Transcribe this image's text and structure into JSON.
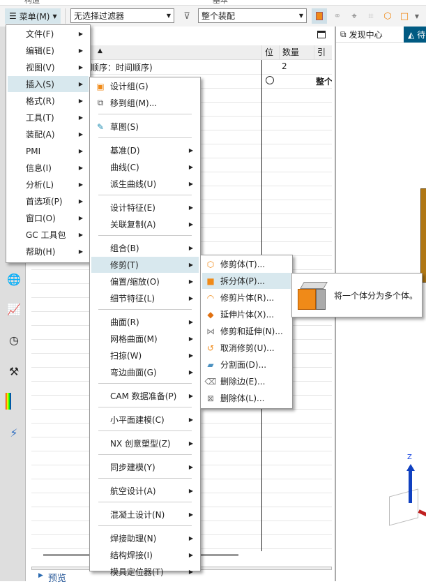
{
  "top_labels": [
    "构造",
    "基本"
  ],
  "toolbar": {
    "menu_label": "菜单(M)",
    "filter_value": "无选择过滤器",
    "scope_value": "整个装配"
  },
  "navigator": {
    "columns": [
      "位",
      "数量",
      "引"
    ],
    "row1_name": "顺序：时间顺序)",
    "row1_qty": "2",
    "row2_ref": "整个",
    "preview_label": "预览"
  },
  "right_panel": {
    "tabs": [
      "发现中心",
      "待"
    ],
    "axis_label": "Z"
  },
  "colors": {
    "accent": "#005a82",
    "hover": "#d8e8ee",
    "orange": "#f08a18"
  },
  "main_menu": [
    {
      "label": "文件(F)"
    },
    {
      "label": "编辑(E)"
    },
    {
      "label": "视图(V)"
    },
    {
      "label": "插入(S)",
      "hover": true
    },
    {
      "label": "格式(R)"
    },
    {
      "label": "工具(T)"
    },
    {
      "label": "装配(A)"
    },
    {
      "label": "PMI"
    },
    {
      "label": "信息(I)"
    },
    {
      "label": "分析(L)"
    },
    {
      "label": "首选项(P)"
    },
    {
      "label": "窗口(O)"
    },
    {
      "label": "GC 工具包"
    },
    {
      "label": "帮助(H)"
    }
  ],
  "insert_menu": [
    {
      "label": "设计组(G)",
      "icon": "design-group-icon",
      "arrow": false
    },
    {
      "label": "移到组(M)...",
      "icon": "move-to-group-icon",
      "arrow": false
    },
    {
      "sep": true
    },
    {
      "label": "草图(S)",
      "icon": "sketch-icon",
      "arrow": false
    },
    {
      "sep": true
    },
    {
      "label": "基准(D)"
    },
    {
      "label": "曲线(C)"
    },
    {
      "label": "派生曲线(U)"
    },
    {
      "sep": true
    },
    {
      "label": "设计特征(E)"
    },
    {
      "label": "关联复制(A)"
    },
    {
      "sep": true
    },
    {
      "label": "组合(B)"
    },
    {
      "label": "修剪(T)",
      "hover": true
    },
    {
      "label": "偏置/缩放(O)"
    },
    {
      "label": "细节特征(L)"
    },
    {
      "sep": true
    },
    {
      "label": "曲面(R)"
    },
    {
      "label": "网格曲面(M)"
    },
    {
      "label": "扫掠(W)"
    },
    {
      "label": "弯边曲面(G)"
    },
    {
      "sep": true
    },
    {
      "label": "CAM 数据准备(P)"
    },
    {
      "sep": true
    },
    {
      "label": "小平面建模(C)"
    },
    {
      "sep": true
    },
    {
      "label": "NX 创意塑型(Z)"
    },
    {
      "sep": true
    },
    {
      "label": "同步建模(Y)"
    },
    {
      "sep": true
    },
    {
      "label": "航空设计(A)"
    },
    {
      "sep": true
    },
    {
      "label": "混凝土设计(N)"
    },
    {
      "sep": true
    },
    {
      "label": "焊接助理(N)"
    },
    {
      "label": "结构焊接(I)"
    },
    {
      "label": "模具定位器(T)"
    }
  ],
  "trim_menu": [
    {
      "label": "修剪体(T)...",
      "icon": "trim-body-icon"
    },
    {
      "label": "拆分体(P)...",
      "icon": "split-body-icon",
      "hover": true
    },
    {
      "label": "修剪片体(R)...",
      "icon": "trim-sheet-icon"
    },
    {
      "label": "延伸片体(X)...",
      "icon": "extend-sheet-icon"
    },
    {
      "label": "修剪和延伸(N)...",
      "icon": "trim-and-extend-icon"
    },
    {
      "label": "取消修剪(U)...",
      "icon": "untrim-icon"
    },
    {
      "label": "分割面(D)...",
      "icon": "divide-face-icon"
    },
    {
      "label": "删除边(E)...",
      "icon": "delete-edge-icon"
    },
    {
      "label": "删除体(L)...",
      "icon": "delete-body-icon"
    }
  ],
  "tooltip": {
    "text": "将一个体分为多个体。",
    "icon": "split-body-icon"
  }
}
